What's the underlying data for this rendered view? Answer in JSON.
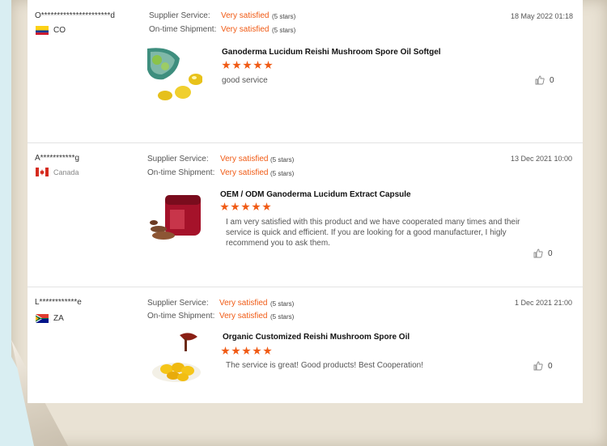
{
  "colors": {
    "accent": "#f05a14",
    "frame": "#e9e2d4",
    "background": "#d9eef2"
  },
  "reviews": [
    {
      "user": "O**********************d",
      "country_code": "CO",
      "flag": "colombia-flag-icon",
      "supplier_label": "Supplier Service:",
      "supplier_value": "Very satisfied",
      "supplier_stars": "(5 stars)",
      "shipment_label": "On-time Shipment:",
      "shipment_value": "Very satisfied",
      "shipment_stars": "(5 stars)",
      "date": "18 May 2022 01:18",
      "product_title": "Ganoderma Lucidum Reishi Mushroom Spore Oil Softgel",
      "rating": 5,
      "comment": "good service",
      "likes": "0"
    },
    {
      "user": "A***********g",
      "country_code": "Canada",
      "flag": "canada-flag-icon",
      "supplier_label": "Supplier Service:",
      "supplier_value": "Very satisfied",
      "supplier_stars": "(5 stars)",
      "shipment_label": "On-time Shipment:",
      "shipment_value": "Very satisfied",
      "shipment_stars": "(5 stars)",
      "date": "13 Dec 2021 10:00",
      "product_title": "OEM / ODM Ganoderma Lucidum Extract Capsule",
      "rating": 5,
      "comment_lines": [
        "I am very satisfied with this product and we have cooperated many times and their",
        "service is quick and efficient. If you are looking for a good manufacturer, I higly",
        "recommend you to ask them."
      ],
      "likes": "0"
    },
    {
      "user": "L************e",
      "country_code": "ZA",
      "flag": "south-africa-flag-icon",
      "supplier_label": "Supplier Service:",
      "supplier_value": "Very satisfied",
      "supplier_stars": "(5 stars)",
      "shipment_label": "On-time Shipment:",
      "shipment_value": "Very satisfied",
      "shipment_stars": "(5 stars)",
      "date": "1 Dec 2021  21:00",
      "product_title": "Organic Customized Reishi Mushroom Spore Oil",
      "rating": 5,
      "comment": "The service is great! Good products! Best Cooperation!",
      "likes": "0"
    }
  ]
}
